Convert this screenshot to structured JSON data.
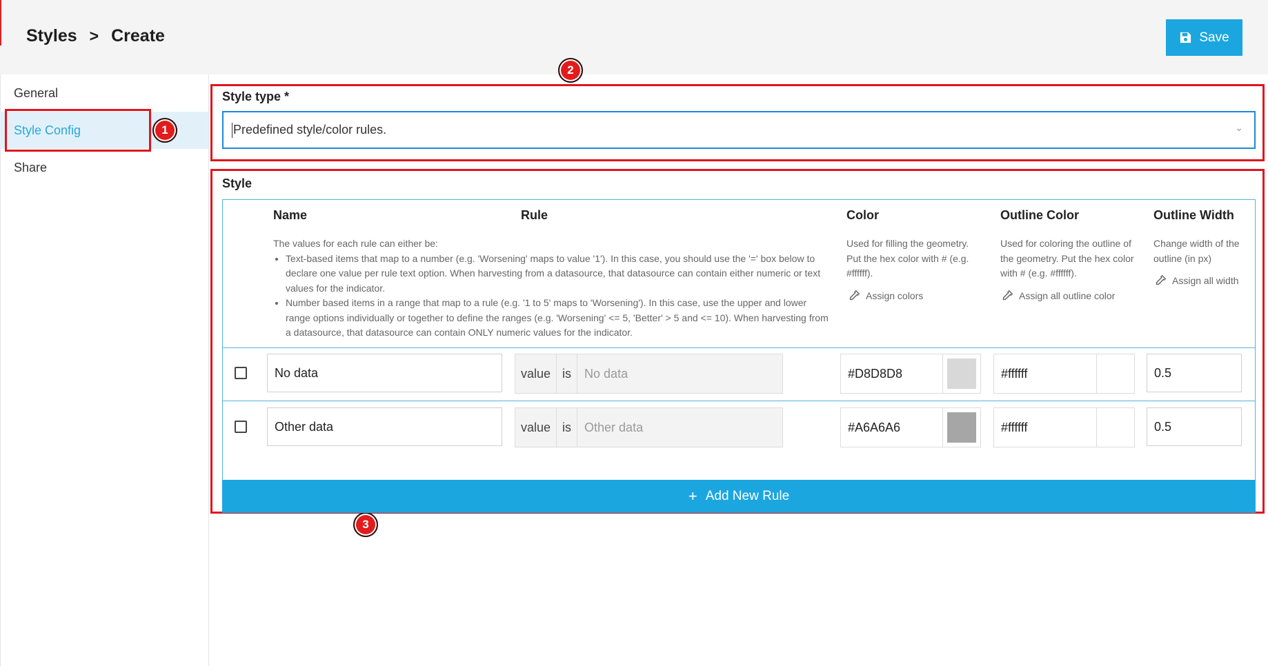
{
  "header": {
    "breadcrumb": [
      "Styles",
      "Create"
    ],
    "breadcrumb_sep": ">",
    "save_label": "Save"
  },
  "sidebar": {
    "items": [
      {
        "label": "General",
        "active": false
      },
      {
        "label": "Style Config",
        "active": true
      },
      {
        "label": "Share",
        "active": false
      }
    ]
  },
  "annotations": [
    "1",
    "2",
    "3"
  ],
  "style_type": {
    "label": "Style type *",
    "value": "Predefined style/color rules."
  },
  "style": {
    "label": "Style",
    "columns": {
      "name": "Name",
      "rule": "Rule",
      "color": "Color",
      "outline_color": "Outline Color",
      "outline_width": "Outline Width"
    },
    "help": {
      "rule_intro": "The values for each rule can either be:",
      "rule_bullet_1": "Text-based items that map to a number (e.g. 'Worsening' maps to value '1'). In this case, you should use the '=' box below to declare one value per rule text option. When harvesting from a datasource, that datasource can contain either numeric or text values for the indicator.",
      "rule_bullet_2": "Number based items in a range that map to a rule (e.g. '1 to 5' maps to 'Worsening'). In this case, use the upper and lower range options individually or together to define the ranges (e.g. 'Worsening' <= 5, 'Better' > 5 and <= 10). When harvesting from a datasource, that datasource can contain ONLY numeric values for the indicator.",
      "color": "Used for filling the geometry. Put the hex color with # (e.g. #ffffff).",
      "outline_color": "Used for coloring the outline of the geometry. Put the hex color with # (e.g. #ffffff).",
      "outline_width": "Change width of the outline (in px)"
    },
    "assign": {
      "color": "Assign colors",
      "outline_color": "Assign all outline color",
      "outline_width": "Assign all width"
    },
    "rows": [
      {
        "name": "No data",
        "rule_key": "value",
        "rule_op": "is",
        "rule_placeholder": "No data",
        "color": "#D8D8D8",
        "swatch": "#D8D8D8",
        "outline_color": "#ffffff",
        "outline_width": "0.5"
      },
      {
        "name": "Other data",
        "rule_key": "value",
        "rule_op": "is",
        "rule_placeholder": "Other data",
        "color": "#A6A6A6",
        "swatch": "#A6A6A6",
        "outline_color": "#ffffff",
        "outline_width": "0.5"
      }
    ],
    "add_rule_label": "Add New Rule"
  },
  "colors": {
    "accent": "#1ba6df",
    "annotation_red": "#e0141e",
    "active_nav_bg": "#e2f1f9"
  }
}
